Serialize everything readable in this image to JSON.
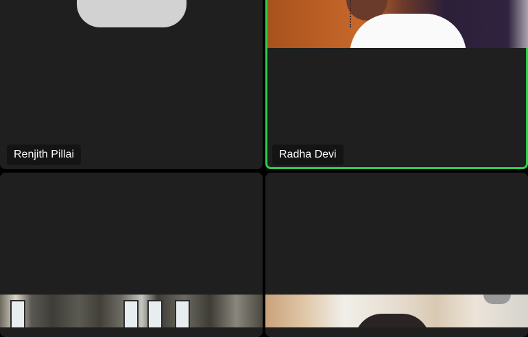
{
  "participants": [
    {
      "name": "Renjith Pillai",
      "active": false
    },
    {
      "name": "Radha Devi",
      "active": true
    }
  ],
  "colors": {
    "tile_background": "#1f1f1f",
    "active_speaker_border": "#2fd14a",
    "label_background": "#141414"
  }
}
